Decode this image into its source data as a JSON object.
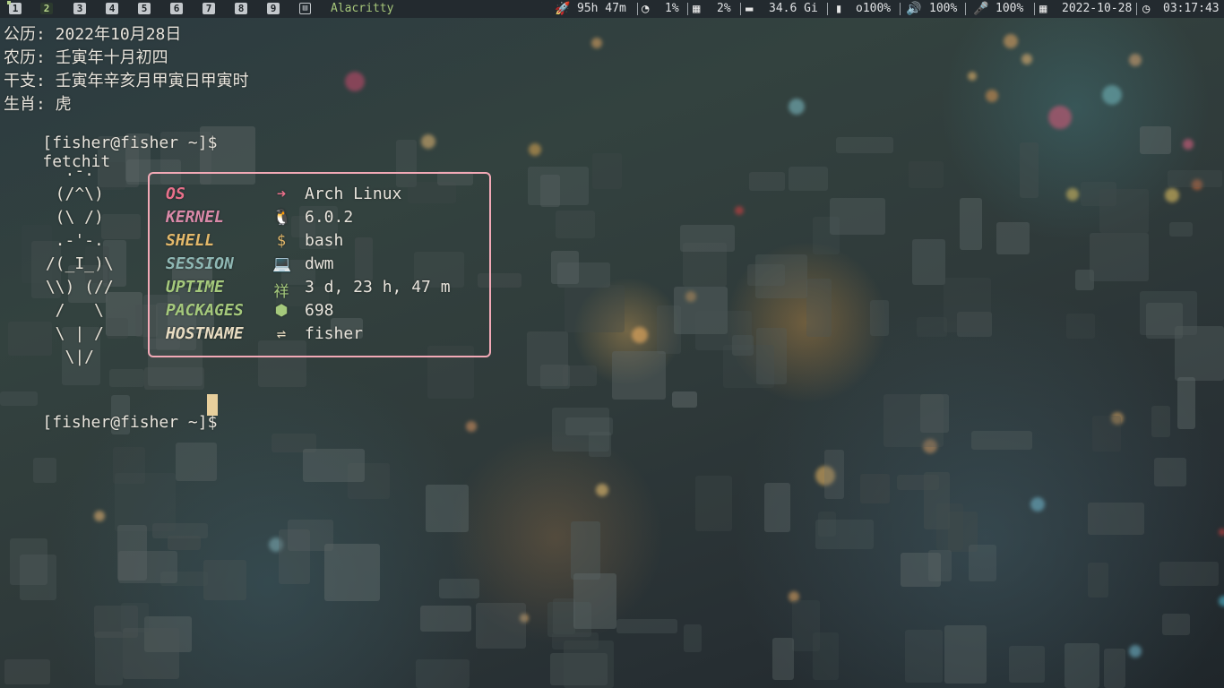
{
  "statusbar": {
    "tags": [
      {
        "label": "1",
        "state": "occupied"
      },
      {
        "label": "2",
        "state": "active"
      },
      {
        "label": "3",
        "state": "normal"
      },
      {
        "label": "4",
        "state": "normal"
      },
      {
        "label": "5",
        "state": "normal"
      },
      {
        "label": "6",
        "state": "normal"
      },
      {
        "label": "7",
        "state": "normal"
      },
      {
        "label": "8",
        "state": "normal"
      },
      {
        "label": "9",
        "state": "normal"
      }
    ],
    "window_title": "Alacritty",
    "uptime": "95h 47m",
    "cpu": "1%",
    "memory": "2%",
    "disk": "34.6 Gi",
    "battery": "o100%",
    "volume": "100%",
    "mic": "100%",
    "date": "2022-10-28",
    "time": "03:17:43",
    "accent_color": "#b6d38a"
  },
  "terminal": {
    "calendar_lines": [
      "公历: 2022年10月28日",
      "农历: 壬寅年十月初四",
      "干支: 壬寅年辛亥月甲寅日甲寅时",
      "生肖: 虎"
    ],
    "prompt": "[fisher@fisher ~]$",
    "command": "fetchit",
    "ascii_art": [
      "   .-.",
      "  (/^\\)",
      "  (\\ /)",
      "  .-'-.",
      " /(_I_)\\",
      " \\\\) (//",
      "  /   \\",
      "  \\ | /",
      "   \\|/"
    ],
    "info": [
      {
        "label": "OS",
        "icon": "arrow-circle-icon",
        "glyph": "➜",
        "value": "Arch Linux",
        "color": "#e8708a"
      },
      {
        "label": "KERNEL",
        "icon": "penguin-icon",
        "glyph": "🐧",
        "value": "6.0.2",
        "color": "#d989a8"
      },
      {
        "label": "SHELL",
        "icon": "dollar-icon",
        "glyph": "$",
        "value": "bash",
        "color": "#e3b86a"
      },
      {
        "label": "SESSION",
        "icon": "laptop-icon",
        "glyph": "💻",
        "value": "dwm",
        "color": "#8fb8b4"
      },
      {
        "label": "UPTIME",
        "icon": "uptime-icon",
        "glyph": "祥",
        "value": "3 d, 23 h, 47 m",
        "color": "#a5c97c"
      },
      {
        "label": "PACKAGES",
        "icon": "package-icon",
        "glyph": "⬢",
        "value": "698",
        "color": "#a5c97c"
      },
      {
        "label": "HOSTNAME",
        "icon": "signpost-icon",
        "glyph": "⇌",
        "value": "fisher",
        "color": "#e8dcc2"
      }
    ],
    "info_border_color": "#f2a9b6"
  }
}
